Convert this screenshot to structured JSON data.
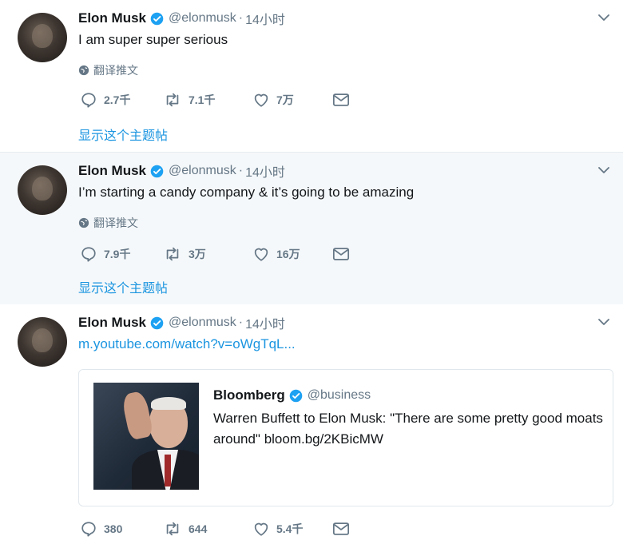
{
  "colors": {
    "accent": "#1b95e0",
    "verified": "#1da1f2",
    "muted": "#657786",
    "highlight_bg": "#f5f8fa"
  },
  "tweets": [
    {
      "author": "Elon Musk",
      "handle": "@elonmusk",
      "separator": "·",
      "time": "14小时",
      "text": "I am super super serious",
      "translate": "翻译推文",
      "replies": "2.7千",
      "retweets": "7.1千",
      "likes": "7万",
      "show_thread": "显示这个主题帖"
    },
    {
      "author": "Elon Musk",
      "handle": "@elonmusk",
      "separator": "·",
      "time": "14小时",
      "text": "I’m starting a candy company & it’s going to be amazing",
      "translate": "翻译推文",
      "replies": "7.9千",
      "retweets": "3万",
      "likes": "16万",
      "show_thread": "显示这个主题帖"
    },
    {
      "author": "Elon Musk",
      "handle": "@elonmusk",
      "separator": "·",
      "time": "14小时",
      "link": "m.youtube.com/watch?v=oWgTqL...",
      "quote": {
        "author": "Bloomberg",
        "handle": "@business",
        "text": "Warren Buffett to Elon Musk: \"There are some pretty good moats around\" bloom.bg/2KBicMW"
      },
      "replies": "380",
      "retweets": "644",
      "likes": "5.4千"
    }
  ],
  "icons": {
    "verified": "verified-badge-icon",
    "caret": "chevron-down-icon",
    "globe": "globe-icon",
    "reply": "reply-icon",
    "retweet": "retweet-icon",
    "like": "heart-icon",
    "dm": "envelope-icon"
  }
}
